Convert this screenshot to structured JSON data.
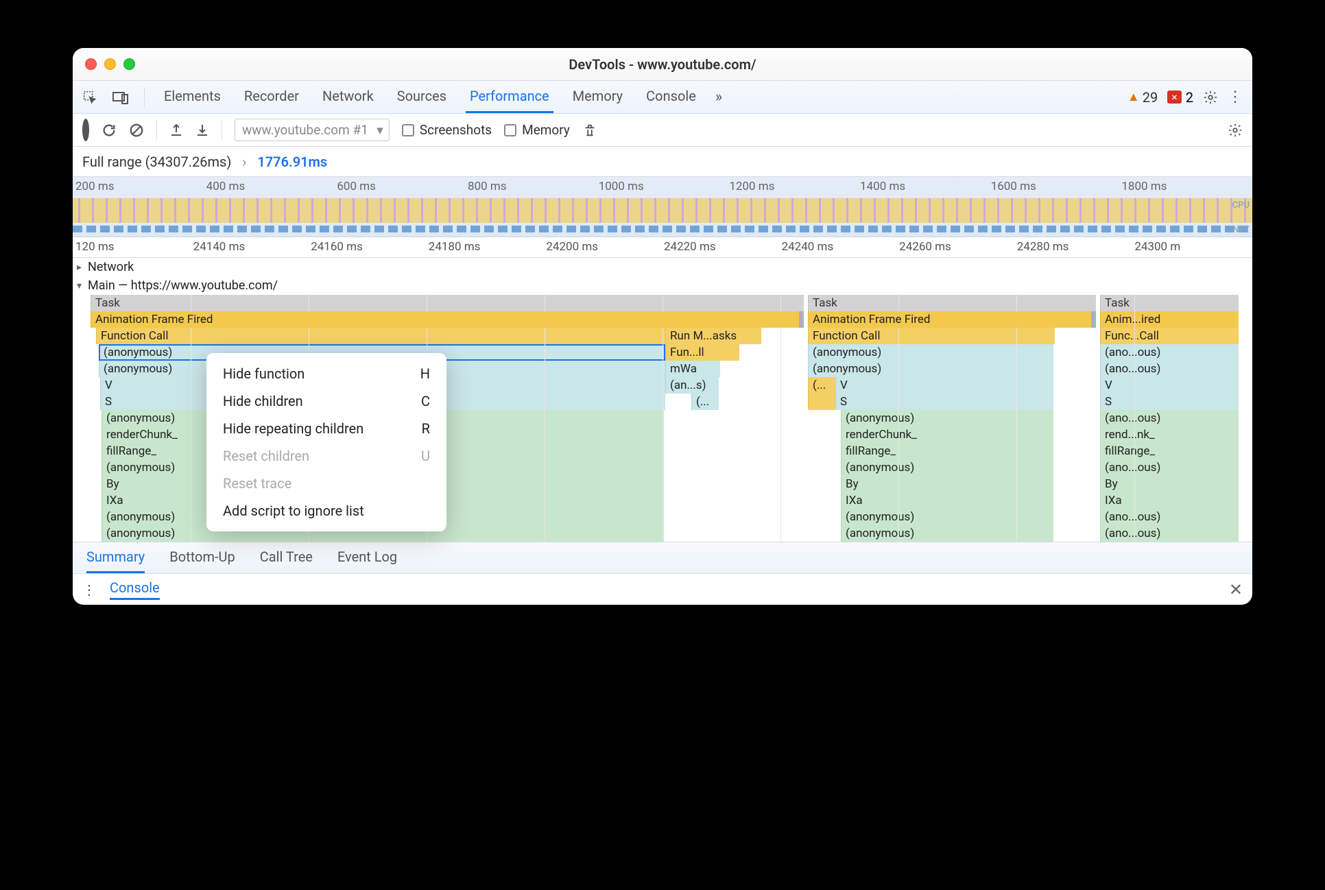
{
  "window_title": "DevTools - www.youtube.com/",
  "tabs": [
    "Elements",
    "Recorder",
    "Network",
    "Sources",
    "Performance",
    "Memory",
    "Console"
  ],
  "active_tab": "Performance",
  "issues_warn": 29,
  "issues_err": 2,
  "recording_select": "www.youtube.com #1",
  "screenshots_label": "Screenshots",
  "memory_label": "Memory",
  "breadcrumb_full": "Full range (34307.26ms)",
  "breadcrumb_cur": "1776.91ms",
  "overview_ticks": [
    "200 ms",
    "400 ms",
    "600 ms",
    "800 ms",
    "1000 ms",
    "1200 ms",
    "1400 ms",
    "1600 ms",
    "1800 ms"
  ],
  "overview_labels": {
    "cpu": "CPU",
    "net": "NET"
  },
  "ruler_ticks": [
    "120 ms",
    "24140 ms",
    "24160 ms",
    "24180 ms",
    "24200 ms",
    "24220 ms",
    "24240 ms",
    "24260 ms",
    "24280 ms",
    "24300 m"
  ],
  "network_hdr": "Network",
  "main_hdr": "Main — https://www.youtube.com/",
  "flame_labels": {
    "task": "Task",
    "aff": "Animation Frame Fired",
    "fc": "Function Call",
    "runm": "Run M...asks",
    "anon": "(anonymous)",
    "funll": "Fun...ll",
    "mwa": "mWa",
    "ans": "(an...s)",
    "ellipsis": "(...",
    "v": "V",
    "s": "S",
    "render": "renderChunk_",
    "fill": "fillRange_",
    "by": "By",
    "ixa": "IXa",
    "aff2": "Anim...ired",
    "fc2": "Func...Call",
    "anon2": "(ano...ous)",
    "render2": "rend...nk_",
    "dotdot": "(..."
  },
  "context_menu": {
    "hide_function": "Hide function",
    "hide_function_key": "H",
    "hide_children": "Hide children",
    "hide_children_key": "C",
    "hide_repeating": "Hide repeating children",
    "hide_repeating_key": "R",
    "reset_children": "Reset children",
    "reset_children_key": "U",
    "reset_trace": "Reset trace",
    "add_ignore": "Add script to ignore list"
  },
  "bottom_tabs": [
    "Summary",
    "Bottom-Up",
    "Call Tree",
    "Event Log"
  ],
  "active_bottom": "Summary",
  "drawer_tab": "Console"
}
